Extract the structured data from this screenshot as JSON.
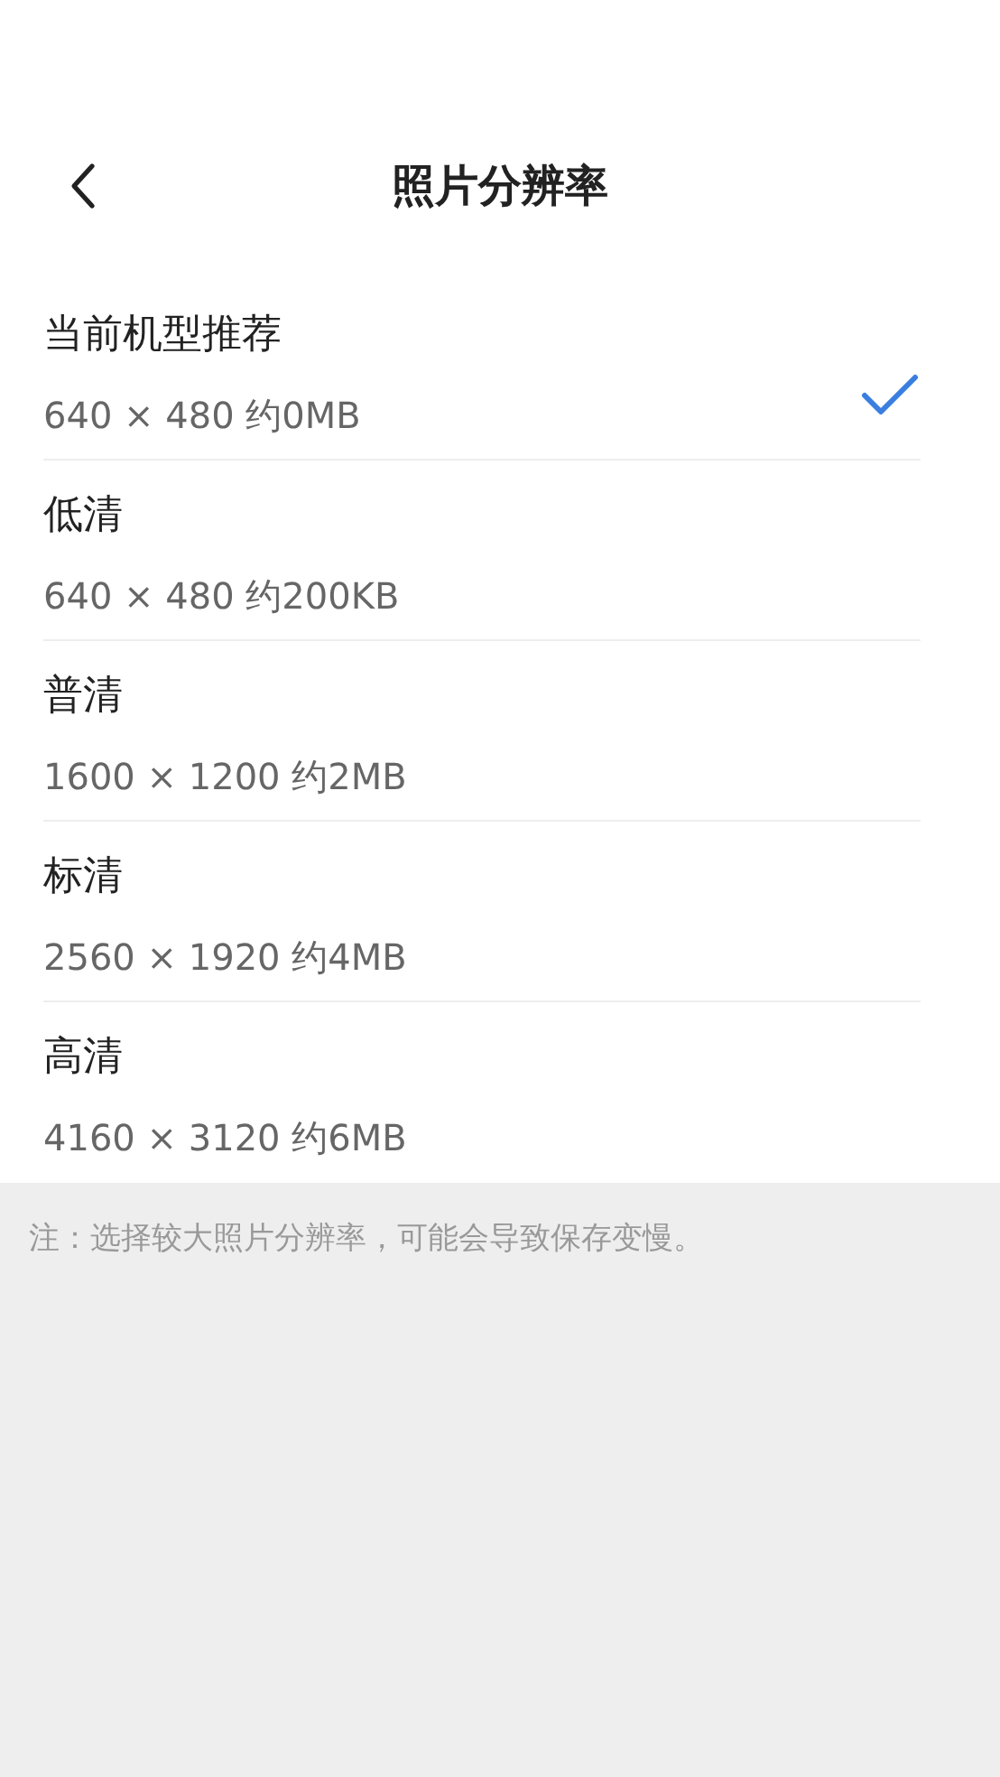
{
  "header": {
    "title": "照片分辨率"
  },
  "options": [
    {
      "name": "当前机型推荐",
      "detail": "640 × 480 约0MB",
      "selected": true
    },
    {
      "name": "低清",
      "detail": "640 × 480 约200KB",
      "selected": false
    },
    {
      "name": "普清",
      "detail": "1600 × 1200 约2MB",
      "selected": false
    },
    {
      "name": "标清",
      "detail": "2560 × 1920 约4MB",
      "selected": false
    },
    {
      "name": "高清",
      "detail": "4160 × 3120 约6MB",
      "selected": false
    }
  ],
  "note": "注：选择较大照片分辨率，可能会导致保存变慢。"
}
